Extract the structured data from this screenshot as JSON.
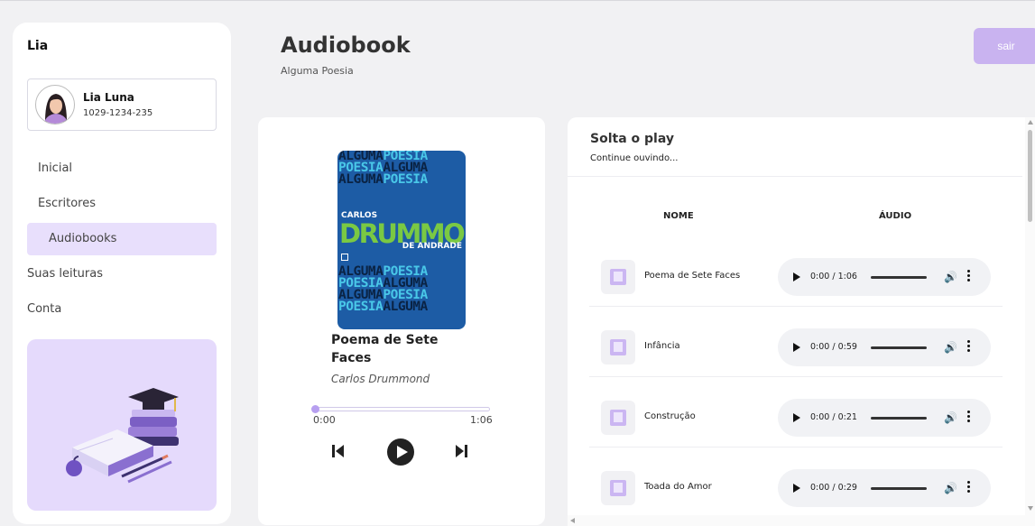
{
  "sidebar": {
    "brand": "Lia",
    "profile": {
      "name": "Lia Luna",
      "id": "1029-1234-235"
    },
    "nav": [
      {
        "label": "Inicial"
      },
      {
        "label": "Escritores"
      },
      {
        "label": "Audiobooks",
        "active": true
      },
      {
        "label": "Suas leituras"
      },
      {
        "label": "Conta"
      }
    ]
  },
  "header": {
    "title": "Audiobook",
    "subtitle": "Alguma Poesia",
    "logout_label": "sair"
  },
  "player": {
    "cover": {
      "words": [
        "ALGUMA",
        "POESIA"
      ],
      "author_first": "CARLOS",
      "author_main": "DRUMMOND",
      "author_last": "DE ANDRADE"
    },
    "track_title": "Poema de Sete Faces",
    "track_author": "Carlos Drummond",
    "time_current": "0:00",
    "time_total": "1:06",
    "progress_fraction": 0
  },
  "list": {
    "title": "Solta o play",
    "subtitle": "Continue ouvindo...",
    "columns": {
      "name": "NOME",
      "audio": "ÁUDIO"
    },
    "rows": [
      {
        "name": "Poema de Sete Faces",
        "time": "0:00 / 1:06"
      },
      {
        "name": "Infância",
        "time": "0:00 / 0:59"
      },
      {
        "name": "Construção",
        "time": "0:00 / 0:21"
      },
      {
        "name": "Toada do Amor",
        "time": "0:00 / 0:29"
      }
    ]
  },
  "colors": {
    "accent": "#c9b3f0",
    "active_nav": "#e8dffc",
    "illustration_bg": "#e5dafc",
    "cover_blue": "#1d5ca5",
    "cover_green": "#7ac943"
  }
}
